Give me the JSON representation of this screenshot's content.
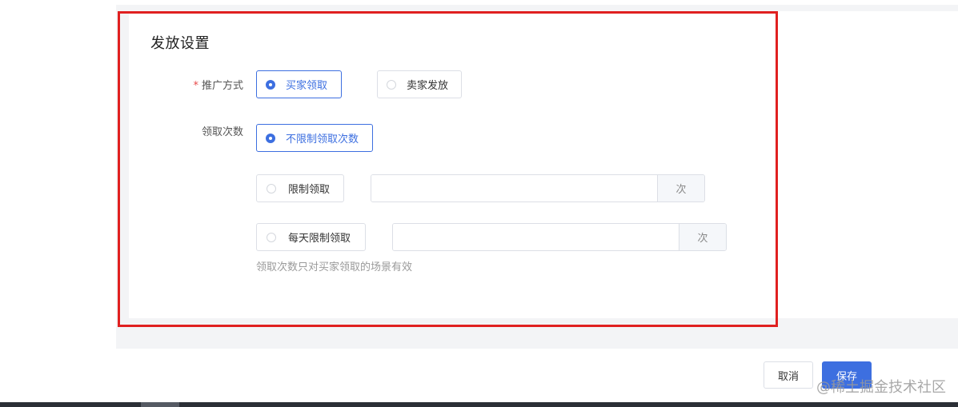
{
  "section": {
    "title": "发放设置"
  },
  "promotion": {
    "required_mark": "*",
    "label": "推广方式",
    "options": [
      {
        "label": "买家领取",
        "selected": true
      },
      {
        "label": "卖家发放",
        "selected": false
      }
    ]
  },
  "claim_limit": {
    "label": "领取次数",
    "options": [
      {
        "label": "不限制领取次数",
        "selected": true
      },
      {
        "label": "限制领取",
        "selected": false,
        "input_value": "",
        "suffix": "次"
      },
      {
        "label": "每天限制领取",
        "selected": false,
        "input_value": "",
        "suffix": "次"
      }
    ],
    "hint": "领取次数只对买家领取的场景有效"
  },
  "footer": {
    "cancel_label": "取消",
    "save_label": "保存"
  },
  "watermark": "@稀土掘金技术社区",
  "colors": {
    "accent": "#3d6fe0",
    "highlight_frame": "#e02020",
    "required": "#e84a4a"
  }
}
